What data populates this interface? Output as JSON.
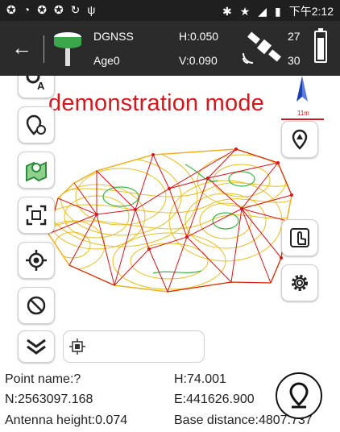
{
  "status_bar": {
    "left_icons": [
      "signal-icon",
      "wifi-icon",
      "notification-icon",
      "notification-icon",
      "sync-icon",
      "usb-icon"
    ],
    "right_icons": [
      "bluetooth-icon",
      "star-icon",
      "network-icon",
      "battery-icon"
    ],
    "time": "下午2:12"
  },
  "toolbar": {
    "mode": "DGNSS",
    "age": "Age0",
    "h_precision": "H:0.050",
    "v_precision": "V:0.090",
    "satellites_tracked": "27",
    "satellites_used": "30",
    "battery_level": 0.85
  },
  "map": {
    "overlay_text": "demonstration mode",
    "scale_label": "11m",
    "accent_color": "#d8141c",
    "left_tools": [
      "layer-label-icon",
      "point-time-icon",
      "map-pin-icon",
      "fit-extent-icon",
      "target-icon",
      "hide-icon",
      "expand-down-icon"
    ],
    "right_tools": [
      "stake-pin-icon",
      "touch-tool-icon",
      "settings-icon"
    ],
    "search_icon": "chip-icon"
  },
  "info": {
    "point_name": "Point name:?",
    "h_value": "H:74.001",
    "n_value": "N:2563097.168",
    "e_value": "E:441626.900",
    "antenna_height": "Antenna height:0.074",
    "base_distance": "Base distance:4807.737"
  }
}
